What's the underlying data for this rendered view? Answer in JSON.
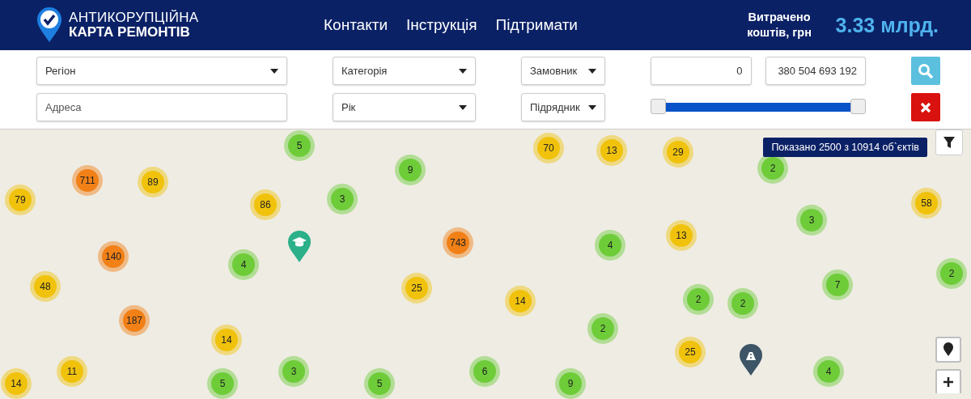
{
  "header": {
    "logo": {
      "line1": "АНТИКОРУПЦІЙНА",
      "line2": "КАРТА РЕМОНТІВ"
    },
    "nav": [
      "Контакти",
      "Інструкція",
      "Підтримати"
    ],
    "spent": {
      "label": "Витрачено коштів, грн",
      "value": "3.33 млрд."
    }
  },
  "filters": {
    "region": {
      "placeholder": "Регіон"
    },
    "address": {
      "placeholder": "Адреса"
    },
    "category": {
      "placeholder": "Категорія"
    },
    "year": {
      "placeholder": "Рік"
    },
    "customer": {
      "placeholder": "Замовник"
    },
    "contractor": {
      "placeholder": "Підрядник"
    },
    "min": {
      "value": "0"
    },
    "max": {
      "value": "380 504 693 192"
    },
    "range": {
      "level": 1
    }
  },
  "map": {
    "info": "Показано 2500 з 10914 об`єктів",
    "clusters": [
      {
        "count": "5",
        "color": "#6ecc39"
      },
      {
        "count": "70",
        "color": "#f0c20c"
      },
      {
        "count": "13",
        "color": "#f0c20c"
      },
      {
        "count": "29",
        "color": "#f0c20c"
      },
      {
        "count": "9",
        "color": "#6ecc39"
      },
      {
        "count": "2",
        "color": "#6ecc39"
      },
      {
        "count": "711",
        "color": "#f18017"
      },
      {
        "count": "89",
        "color": "#f0c20c"
      },
      {
        "count": "79",
        "color": "#f0c20c"
      },
      {
        "count": "86",
        "color": "#f0c20c"
      },
      {
        "count": "3",
        "color": "#6ecc39"
      },
      {
        "count": "58",
        "color": "#f0c20c"
      },
      {
        "count": "3",
        "color": "#6ecc39"
      },
      {
        "count": "743",
        "color": "#f18017"
      },
      {
        "count": "4",
        "color": "#6ecc39"
      },
      {
        "count": "13",
        "color": "#f0c20c"
      },
      {
        "count": "140",
        "color": "#f18017"
      },
      {
        "count": "4",
        "color": "#6ecc39"
      },
      {
        "count": "2",
        "color": "#6ecc39"
      },
      {
        "count": "48",
        "color": "#f0c20c"
      },
      {
        "count": "25",
        "color": "#f0c20c"
      },
      {
        "count": "7",
        "color": "#6ecc39"
      },
      {
        "count": "14",
        "color": "#f0c20c"
      },
      {
        "count": "2",
        "color": "#6ecc39"
      },
      {
        "count": "2",
        "color": "#6ecc39"
      },
      {
        "count": "187",
        "color": "#f18017"
      },
      {
        "count": "2",
        "color": "#6ecc39"
      },
      {
        "count": "14",
        "color": "#f0c20c"
      },
      {
        "count": "25",
        "color": "#f0c20c"
      },
      {
        "count": "11",
        "color": "#f0c20c"
      },
      {
        "count": "3",
        "color": "#6ecc39"
      },
      {
        "count": "6",
        "color": "#6ecc39"
      },
      {
        "count": "4",
        "color": "#6ecc39"
      },
      {
        "count": "14",
        "color": "#f0c20c"
      },
      {
        "count": "5",
        "color": "#6ecc39"
      },
      {
        "count": "5",
        "color": "#6ecc39"
      },
      {
        "count": "9",
        "color": "#6ecc39"
      }
    ],
    "markers": [
      {
        "kind": "education"
      },
      {
        "kind": "road"
      }
    ]
  }
}
